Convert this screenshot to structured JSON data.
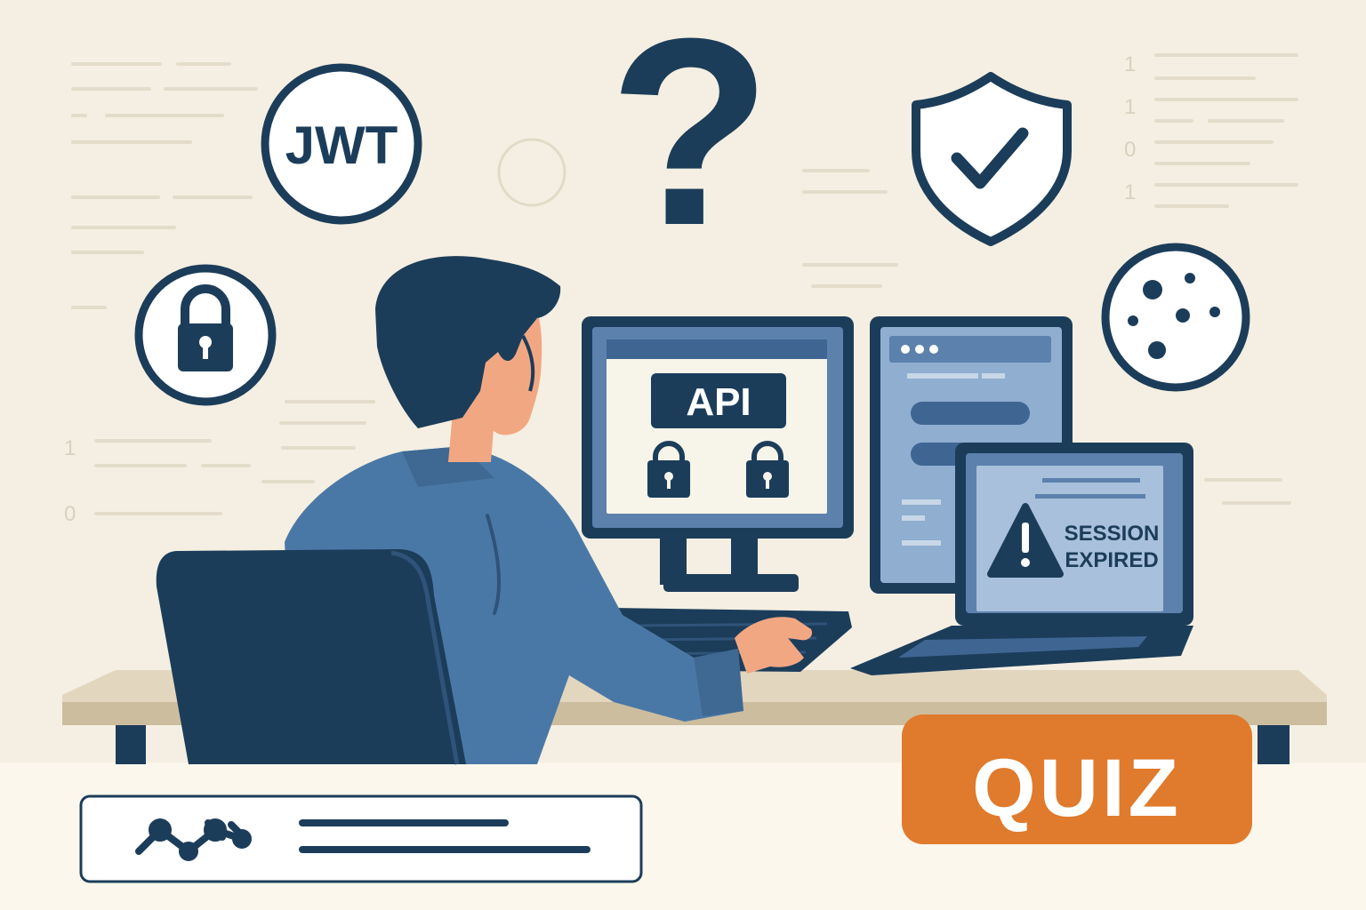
{
  "icons": {
    "jwt_badge": "JWT",
    "question_mark": "?",
    "binary_digits": [
      "1",
      "1",
      "0",
      "1"
    ],
    "left_digits": [
      "1",
      "0"
    ]
  },
  "monitor": {
    "label": "API"
  },
  "laptop": {
    "line1": "SESSION",
    "line2": "EXPIRED"
  },
  "quiz": {
    "label": "QUIZ"
  },
  "colors": {
    "background": "#f4efe2",
    "navy": "#1c3d5a",
    "shirt": "#4a78a6",
    "skin": "#f2a783",
    "desk": "#e2d6bf",
    "accent_orange": "#e07a2c",
    "screen_blue": "#5d81ad"
  }
}
